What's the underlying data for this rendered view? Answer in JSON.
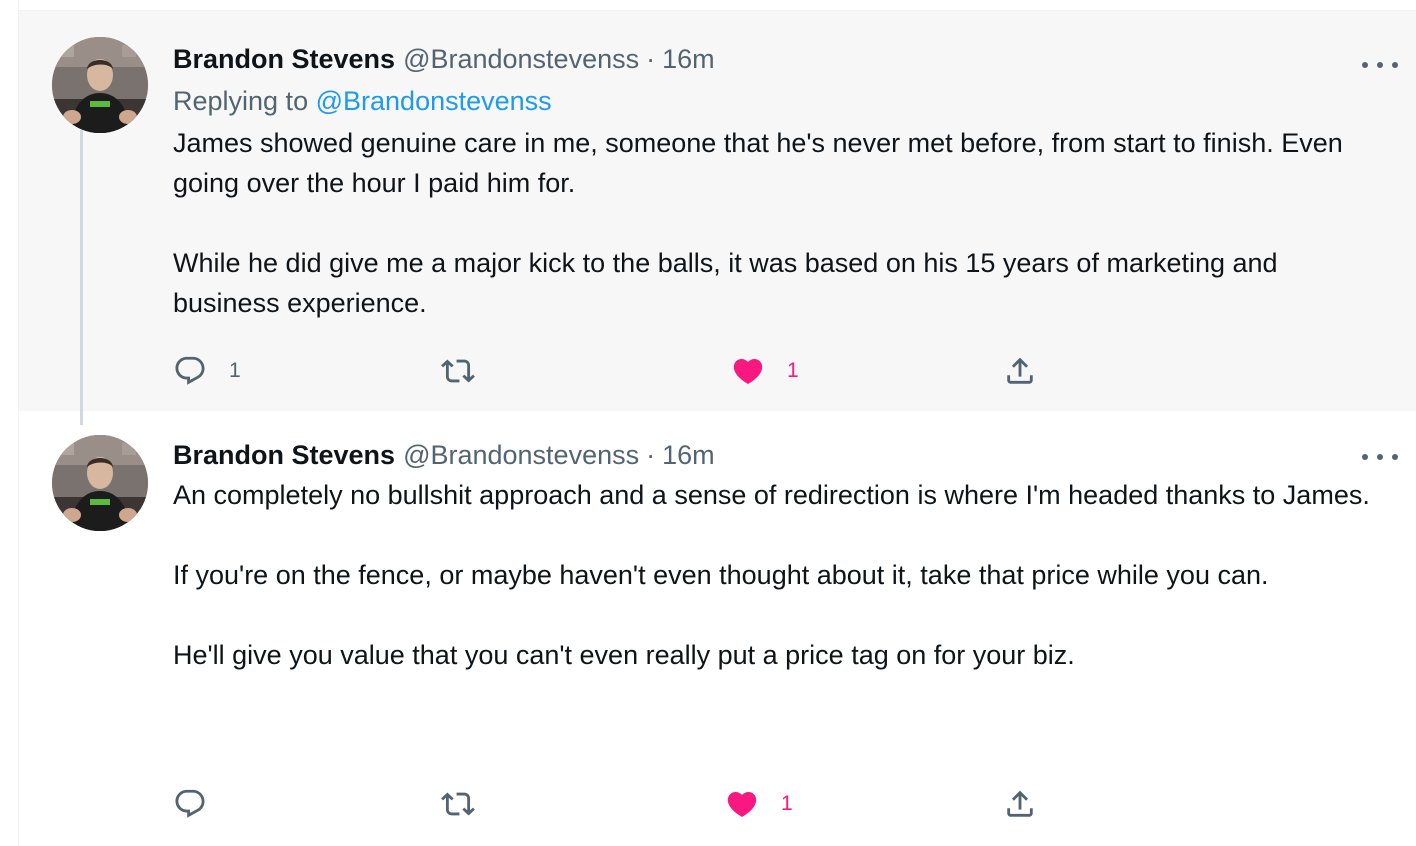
{
  "tweets": [
    {
      "author": {
        "name": "Brandon Stevens",
        "handle": "@Brandonstevenss"
      },
      "separator": "·",
      "time": "16m",
      "replying_to": {
        "prefix": "Replying to",
        "handle": "@Brandonstevenss"
      },
      "paragraphs": [
        "James showed genuine care in me, someone that he's never met before, from start to finish. Even going over the hour I paid him for.",
        "While he did give me a major kick to the balls, it was based on his 15 years of marketing and business experience."
      ],
      "actions": {
        "reply_count": "1",
        "retweet_count": "",
        "like_count": "1",
        "liked": true
      }
    },
    {
      "author": {
        "name": "Brandon Stevens",
        "handle": "@Brandonstevenss"
      },
      "separator": "·",
      "time": "16m",
      "paragraphs": [
        "An completely no bullshit approach and a sense of redirection is where I'm headed thanks to James.",
        "If you're on the fence, or maybe haven't even thought about it, take that price while you can.",
        "He'll give you value that you can't even really put a price tag on for your biz."
      ],
      "actions": {
        "reply_count": "",
        "retweet_count": "",
        "like_count": "1",
        "liked": true
      }
    }
  ],
  "icons": {
    "reply": "reply-icon",
    "retweet": "retweet-icon",
    "like": "heart-filled-icon",
    "share": "share-icon",
    "more": "more-horizontal-icon"
  },
  "colors": {
    "link": "#1d9bf0",
    "like": "#f91880",
    "secondary_text": "#536471",
    "primary_text": "#0f1419",
    "focused_background": "#f7f7f7",
    "thread_line": "#cfd9de"
  }
}
